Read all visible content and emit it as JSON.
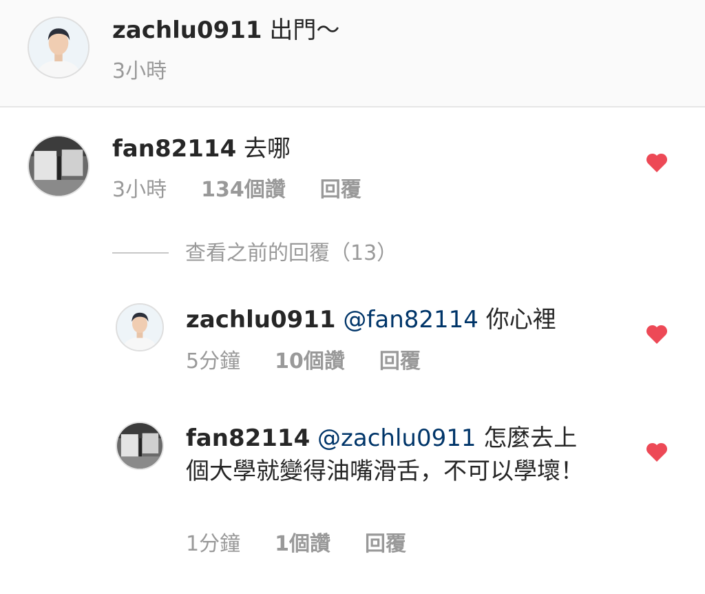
{
  "caption": {
    "username": "zachlu0911",
    "text": "出門～",
    "time": "3小時"
  },
  "comments": [
    {
      "username": "fan82114",
      "text": "去哪",
      "time": "3小時",
      "likes": "134個讚",
      "reply": "回覆"
    }
  ],
  "view_previous": "查看之前的回覆（13）",
  "replies": [
    {
      "username": "zachlu0911",
      "mention": "@fan82114",
      "text": "你心裡",
      "time": "5分鐘",
      "likes": "10個讚",
      "reply": "回覆"
    },
    {
      "username": "fan82114",
      "mention": "@zachlu0911",
      "text": "怎麼去上個大學就變得油嘴滑舌，不可以學壞！",
      "time": "1分鐘",
      "likes": "1個讚",
      "reply": "回覆"
    }
  ],
  "colors": {
    "heart": "#ed4956",
    "mention": "#003569",
    "meta": "#999999"
  }
}
